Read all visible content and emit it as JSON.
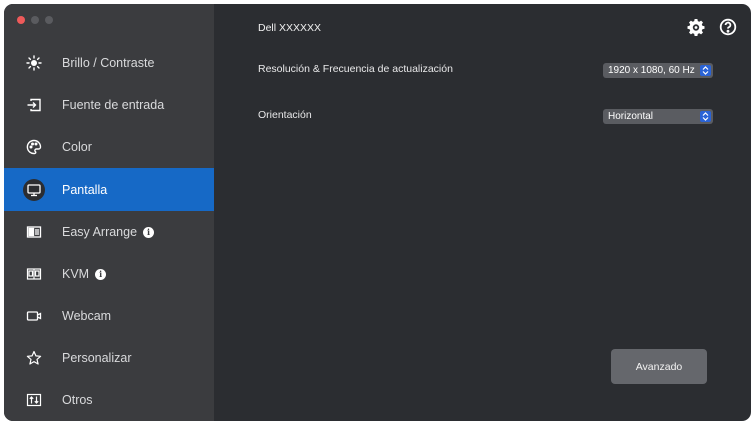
{
  "window": {
    "monitor_name": "Dell XXXXXX"
  },
  "sidebar": {
    "items": [
      {
        "label": "Brillo / Contraste",
        "icon": "sun-icon",
        "info": false,
        "active": false
      },
      {
        "label": "Fuente de entrada",
        "icon": "input-source-icon",
        "info": false,
        "active": false
      },
      {
        "label": "Color",
        "icon": "palette-icon",
        "info": false,
        "active": false
      },
      {
        "label": "Pantalla",
        "icon": "monitor-icon",
        "info": false,
        "active": true
      },
      {
        "label": "Easy Arrange",
        "icon": "layout-icon",
        "info": true,
        "active": false
      },
      {
        "label": "KVM",
        "icon": "kvm-icon",
        "info": true,
        "active": false
      },
      {
        "label": "Webcam",
        "icon": "webcam-icon",
        "info": false,
        "active": false
      },
      {
        "label": "Personalizar",
        "icon": "star-icon",
        "info": false,
        "active": false
      },
      {
        "label": "Otros",
        "icon": "sort-icon",
        "info": false,
        "active": false
      }
    ]
  },
  "header_icons": [
    "gear-icon",
    "help-icon"
  ],
  "settings": {
    "resolution_label": "Resolución & Frecuencia de actualización",
    "resolution_value": "1920 x 1080, 60 Hz",
    "orientation_label": "Orientación",
    "orientation_value": "Horizontal"
  },
  "actions": {
    "advanced_label": "Avanzado"
  },
  "colors": {
    "accent": "#1669c6",
    "sidebar": "#3b3c3f",
    "content": "#2b2d31",
    "close_dot": "#ee5a5a",
    "select_chevron": "#2a63d6"
  }
}
